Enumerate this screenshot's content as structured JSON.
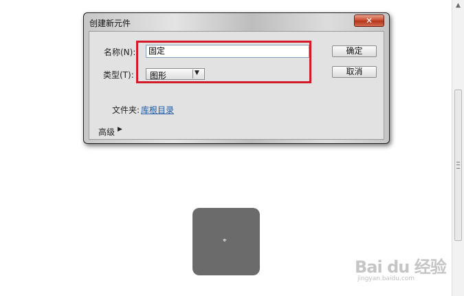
{
  "dialog": {
    "title": "创建新元件",
    "close_glyph": "✕",
    "name_label": "名称(N):",
    "name_value": "固定",
    "type_label": "类型(T):",
    "type_value": "图形",
    "folder_label": "文件夹:",
    "folder_link": "库根目录",
    "advanced_label": "高级",
    "ok_label": "确定",
    "cancel_label": "取消"
  },
  "canvas": {
    "crosshair_glyph": "⌖"
  },
  "watermark": {
    "logo": "Bai du 经验",
    "url": "jingyan.baidu.com"
  },
  "colors": {
    "highlight": "#d41a28",
    "symbol_fill": "#6b6b6b",
    "link": "#1f5aa6",
    "close_button": "#c8462a"
  },
  "icons": [
    "close-icon",
    "dropdown-arrow-icon",
    "expand-arrow-icon",
    "crosshair-icon",
    "scroll-up-icon",
    "scroll-grip-icon"
  ]
}
